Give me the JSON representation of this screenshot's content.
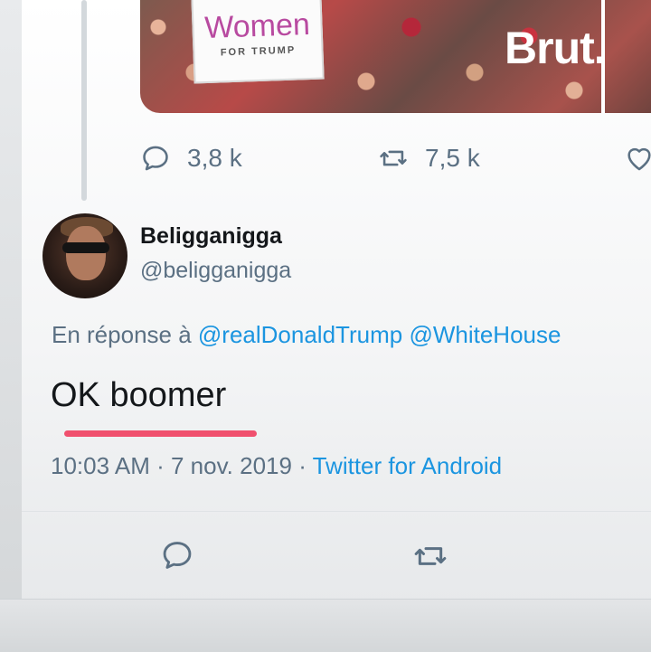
{
  "media": {
    "sign_main": "Women",
    "sign_sub": "FOR TRUMP",
    "watermark": "Brut."
  },
  "parent_tweet": {
    "reply_icon": "reply-icon",
    "reply_count": "3,8 k",
    "retweet_icon": "retweet-icon",
    "retweet_count": "7,5 k",
    "like_icon": "heart-icon"
  },
  "tweet": {
    "author": {
      "display_name": "Beligganigga",
      "handle": "@beligganigga"
    },
    "reply_prefix": "En réponse à",
    "reply_mentions": [
      "@realDonaldTrump",
      "@WhiteHouse"
    ],
    "text": "OK boomer",
    "time": "10:03 AM",
    "date": "7 nov. 2019",
    "source": "Twitter for Android",
    "actions": {
      "reply_icon": "reply-icon",
      "retweet_icon": "retweet-icon"
    }
  },
  "colors": {
    "accent": "#1b95e0",
    "muted": "#5b7083",
    "highlight_underline": "#f0506e"
  }
}
